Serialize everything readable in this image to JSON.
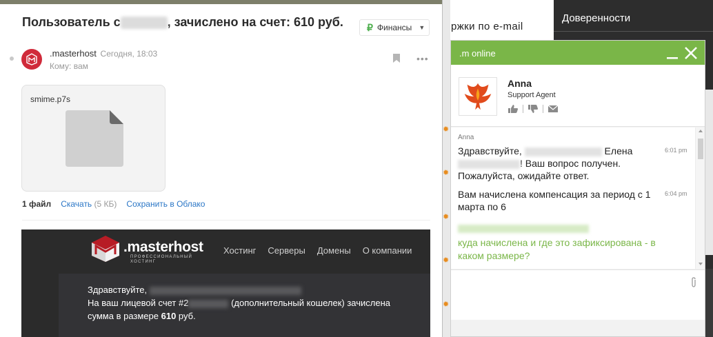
{
  "mail": {
    "subject_prefix": "Пользователь с",
    "subject_suffix": ", зачислено на счет: 610 руб.",
    "folder": {
      "symbol": "₽",
      "label": "Финансы"
    },
    "sender": ".masterhost",
    "time": "Сегодня, 18:03",
    "to": "Кому: вам",
    "attachment": {
      "filename": "smime.p7s",
      "count_label": "1 файл",
      "download_label": "Скачать",
      "size": "(5 КБ)",
      "cloud_label": "Сохранить в Облако"
    },
    "banner": {
      "logo_text": ".masterhost",
      "logo_sub": "ПРОФЕССИОНАЛЬНЫЙ ХОСТИНГ",
      "nav": [
        "Хостинг",
        "Серверы",
        "Домены",
        "О компании"
      ],
      "greeting": "Здравствуйте,",
      "line2_prefix": "На ваш лицевой счет #2",
      "line2_suffix": " (дополнительный кошелек) зачислена",
      "line3_prefix": "сумма в размере ",
      "line3_amount": "610",
      "line3_suffix": " руб."
    }
  },
  "background_page": {
    "text": "ржки по e-mail",
    "dark_title": "Доверенности"
  },
  "chat": {
    "title": ".m online",
    "agent_name": "Anna",
    "agent_role": "Support Agent",
    "message_author": "Anna",
    "messages": [
      {
        "part1": "Здравствуйте, ",
        "part2": " Елена",
        "part3": "! Ваш вопрос получен. Пожалуйста, ожидайте ответ.",
        "time": "6:01 pm"
      },
      {
        "text": "Вам начислена компенсация за период с 1 марта по 6",
        "time": "6:04 pm"
      }
    ],
    "client_message": "куда начислена и где это зафиксирована - в каком размере?",
    "accent_color": "#7ab648"
  }
}
